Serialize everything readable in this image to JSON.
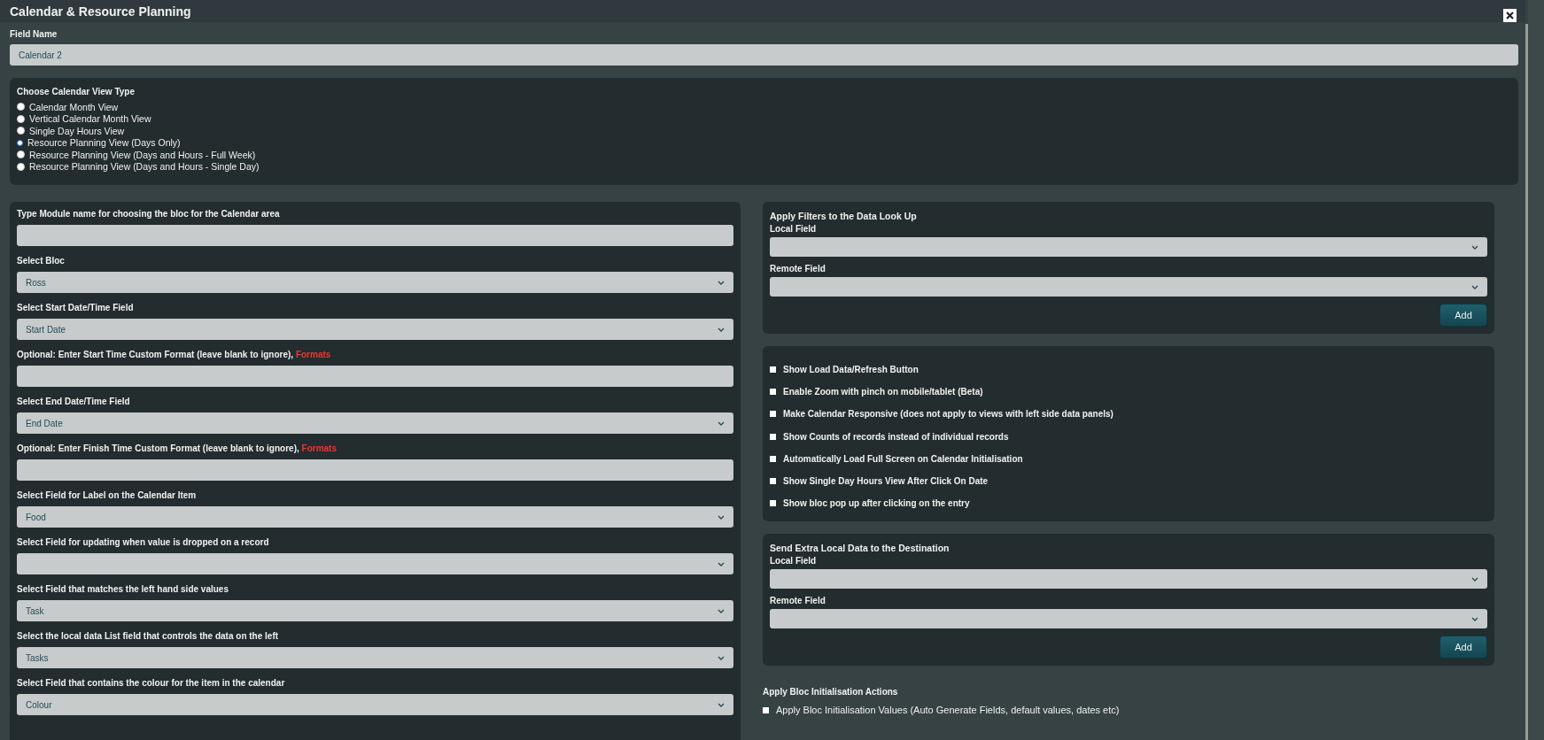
{
  "window": {
    "title": "Calendar & Resource Planning"
  },
  "field_name": {
    "label": "Field Name",
    "value": "Calendar 2"
  },
  "view_type": {
    "title": "Choose Calendar View Type",
    "options": [
      {
        "label": "Calendar Month View",
        "selected": false
      },
      {
        "label": "Vertical Calendar Month View",
        "selected": false
      },
      {
        "label": "Single Day Hours View",
        "selected": false
      },
      {
        "label": "Resource Planning View (Days Only)",
        "selected": true
      },
      {
        "label": "Resource Planning View (Days and Hours - Full Week)",
        "selected": false
      },
      {
        "label": "Resource Planning View (Days and Hours - Single Day)",
        "selected": false
      }
    ]
  },
  "left_panel": {
    "fields": [
      {
        "kind": "input",
        "label": "Type Module name for choosing the bloc for the Calendar area"
      },
      {
        "kind": "select",
        "label": "Select Bloc",
        "value": "Ross"
      },
      {
        "kind": "select",
        "label": "Select Start Date/Time Field",
        "value": "Start Date"
      },
      {
        "kind": "input",
        "label": "Optional: Enter Start Time Custom Format (leave blank to ignore),",
        "link": "Formats"
      },
      {
        "kind": "select",
        "label": "Select End Date/Time Field",
        "value": "End Date"
      },
      {
        "kind": "input",
        "label": "Optional: Enter Finish Time Custom Format (leave blank to ignore),",
        "link": "Formats"
      },
      {
        "kind": "select",
        "label": "Select Field for Label on the Calendar Item",
        "value": "Food"
      },
      {
        "kind": "select",
        "label": "Select Field for updating when value is dropped on a record"
      },
      {
        "kind": "select",
        "label": "Select Field that matches the left hand side values",
        "value": "Task"
      },
      {
        "kind": "select",
        "label": "Select the local data List field that controls the data on the left",
        "value": "Tasks"
      },
      {
        "kind": "select",
        "label": "Select Field that contains the colour for the item in the calendar",
        "value": "Colour"
      }
    ]
  },
  "filters_panel": {
    "title": "Apply Filters to the Data Look Up",
    "fields": [
      {
        "label": "Local Field"
      },
      {
        "label": "Remote Field"
      }
    ],
    "button": "Add"
  },
  "options_panel": {
    "options": [
      {
        "label": "Show Load Data/Refresh Button",
        "checked": false
      },
      {
        "label": "Enable Zoom with pinch on mobile/tablet (Beta)",
        "checked": false
      },
      {
        "label": "Make Calendar Responsive (does not apply to views with left side data panels)",
        "checked": false
      },
      {
        "label": "Show Counts of records instead of individual records",
        "checked": false
      },
      {
        "label": "Automatically Load Full Screen on Calendar Initialisation",
        "checked": false
      },
      {
        "label": "Show Single Day Hours View After Click On Date",
        "checked": false
      },
      {
        "label": "Show bloc pop up after clicking on the entry",
        "checked": false
      }
    ]
  },
  "extra_data_panel": {
    "title": "Send Extra Local Data to the Destination",
    "fields": [
      {
        "label": "Local Field"
      },
      {
        "label": "Remote Field"
      }
    ],
    "button": "Add"
  },
  "init_actions": {
    "title": "Apply Bloc Initialisation Actions",
    "options": [
      {
        "label": "Apply Bloc Initialisation Values (Auto Generate Fields, default values, dates etc)",
        "checked": false
      }
    ]
  }
}
